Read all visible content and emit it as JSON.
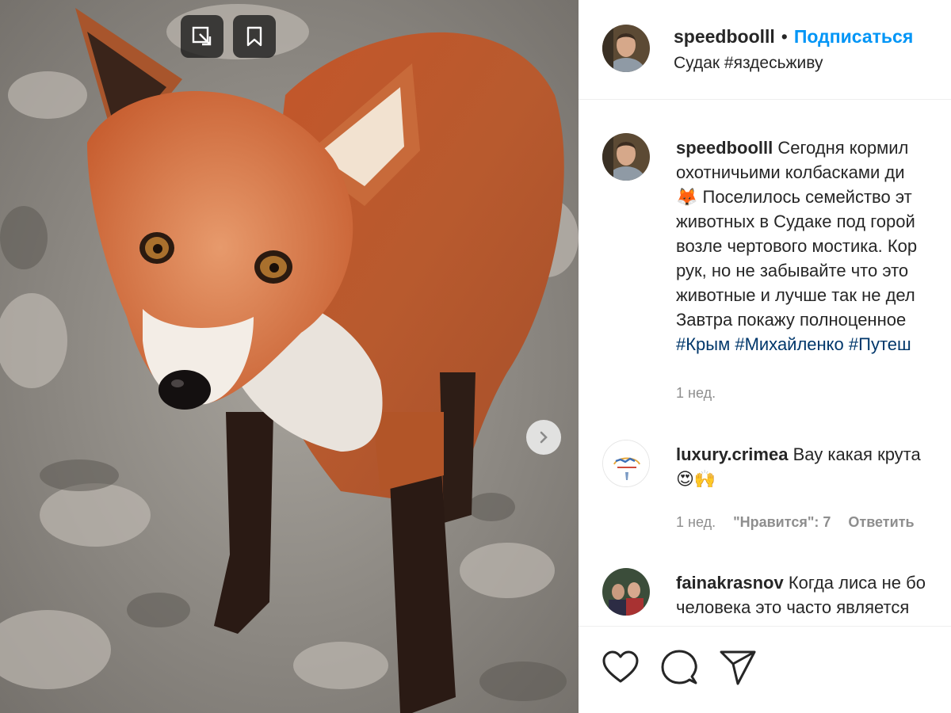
{
  "post": {
    "author": "speedboolll",
    "separator": "•",
    "follow_label": "Подписаться",
    "location": "Судак #яздесьживу"
  },
  "caption": {
    "author": "speedboolll",
    "lines": [
      "Сегодня кормил",
      "охотничьими колбасками ди",
      "🦊 Поселилось семейство эт",
      "животных в Судаке под горой",
      "возле чертового мостика. Кор",
      "рук, но не забывайте что это",
      "животные и лучше так не дел",
      "Завтра покажу полноценное"
    ],
    "hashtags": "#Крым #Михайленко #Путеш",
    "time": "1 нед."
  },
  "comments": [
    {
      "author": "luxury.crimea",
      "text": "Вау какая крута",
      "emoji": "😍🙌",
      "time": "1 нед.",
      "likes": "\"Нравится\": 7",
      "reply": "Ответить"
    },
    {
      "author": "fainakrasnov",
      "line1": "Когда лиса не бо",
      "line2": "человека это часто является"
    }
  ],
  "icons": {
    "expand": "expand-icon",
    "save": "bookmark-icon",
    "next": "chevron-right-icon",
    "like": "heart-icon",
    "comment": "comment-icon",
    "share": "share-icon"
  },
  "colors": {
    "link": "#0095f6",
    "hashtag": "#00376b",
    "muted": "#8e8e8e"
  }
}
